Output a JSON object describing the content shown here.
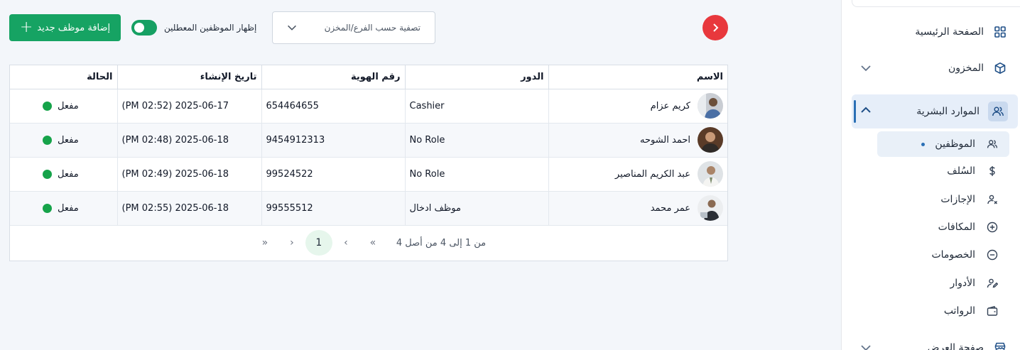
{
  "sidebar": {
    "items": [
      {
        "label": "الصفحة الرئيسية",
        "icon": "grid-icon"
      },
      {
        "label": "المخزون",
        "icon": "box-icon"
      },
      {
        "label": "الموارد البشرية",
        "icon": "users-icon"
      },
      {
        "label": "صفحة العرض",
        "icon": "store-icon"
      }
    ],
    "sub_items": [
      {
        "label": "الموظفين",
        "icon": "users-icon"
      },
      {
        "label": "السُلف",
        "icon": "dollar-icon"
      },
      {
        "label": "الإجازات",
        "icon": "user-x-icon"
      },
      {
        "label": "المكافات",
        "icon": "plus-circle-icon"
      },
      {
        "label": "الخصومات",
        "icon": "minus-circle-icon"
      },
      {
        "label": "الأدوار",
        "icon": "user-edit-icon"
      },
      {
        "label": "الرواتب",
        "icon": "wallet-icon"
      }
    ]
  },
  "toolbar": {
    "filter_placeholder": "تصفية حسب الفرع/المخزن",
    "toggle_label": "إظهار الموظفين المعطلين",
    "toggle_on": true,
    "add_button_label": "إضافة موظف جديد"
  },
  "table": {
    "headers": {
      "name": "الاسم",
      "role": "الدور",
      "id": "رقم الهوية",
      "created": "تاريخ الإنشاء",
      "status": "الحالة"
    },
    "rows": [
      {
        "name": "كريم عزام",
        "role": "Cashier",
        "id": "654464655",
        "created": "2025-06-17 (02:52 PM)",
        "status": "مفعل"
      },
      {
        "name": "احمد الشوحه",
        "role": "No Role",
        "id": "9454912313",
        "created": "2025-06-18 (02:48 PM)",
        "status": "مفعل"
      },
      {
        "name": "عبد الكريم المناصير",
        "role": "No Role",
        "id": "99524522",
        "created": "2025-06-18 (02:49 PM)",
        "status": "مفعل"
      },
      {
        "name": "عمر محمد",
        "role": "موظف ادخال",
        "id": "99555512",
        "created": "2025-06-18 (02:55 PM)",
        "status": "مفعل"
      }
    ]
  },
  "pagination": {
    "summary": "من 1 إلى 4 من أصل 4",
    "current_page": "1",
    "first": "«",
    "prev": "‹",
    "next": "›",
    "last": "»"
  },
  "colors": {
    "primary_green": "#16a363",
    "accent_blue": "#2a6fb5",
    "danger_red": "#e8383d"
  }
}
